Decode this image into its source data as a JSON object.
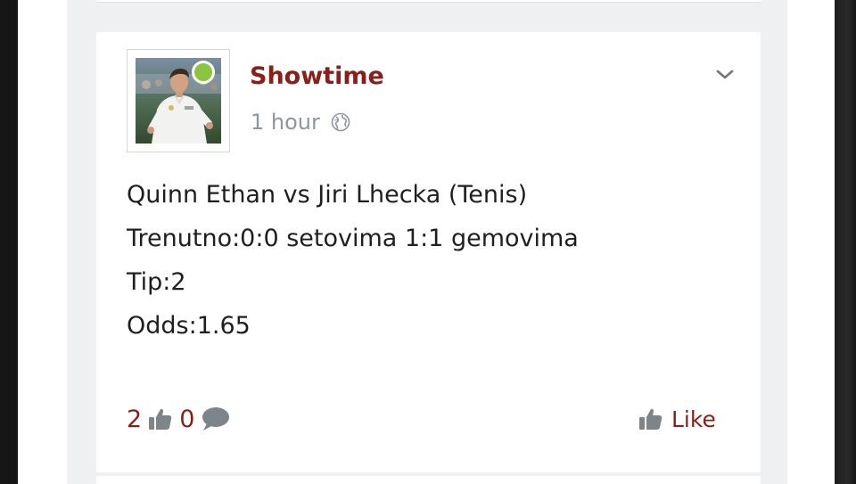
{
  "colors": {
    "accent": "#8a1f1a",
    "muted": "#8e979d",
    "online": "#8bc53f",
    "feed_background": "#eef0f1"
  },
  "post": {
    "author": {
      "name": "Showtime",
      "online": true,
      "avatar_icon": "user-avatar-photo"
    },
    "timestamp": "1 hour",
    "privacy_icon": "globe-icon",
    "menu_icon": "chevron-down-icon",
    "body_lines": [
      "Quinn Ethan vs Jiri Lhecka (Tenis)",
      "Trenutno:0:0 setovima 1:1 gemovima",
      "Tip:2",
      "Odds:1.65"
    ],
    "likes_count": "2",
    "comments_count": "0",
    "like_label": "Like"
  }
}
